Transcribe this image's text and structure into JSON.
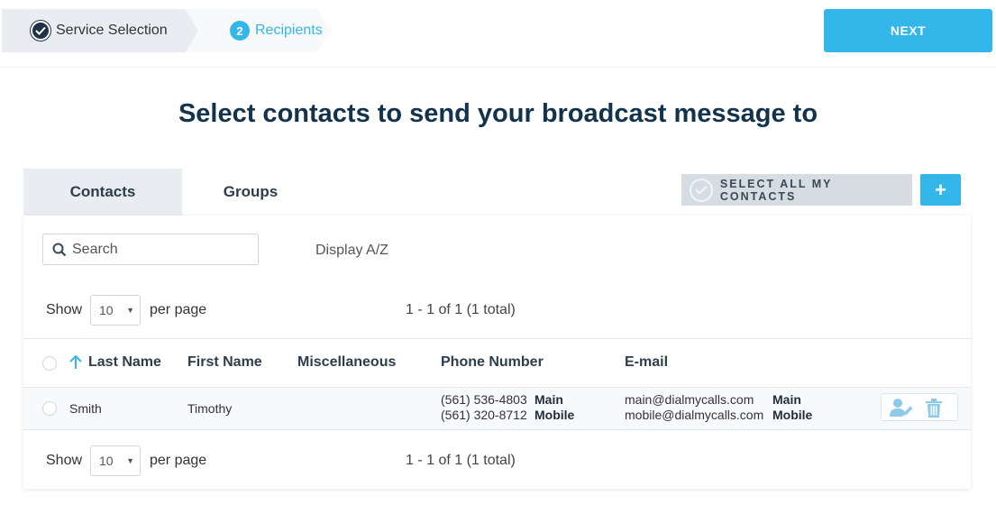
{
  "stepper": {
    "step1": {
      "label": "Service Selection"
    },
    "step2": {
      "number": "2",
      "label": "Recipients"
    }
  },
  "next_label": "NEXT",
  "title": "Select contacts to send your broadcast message to",
  "tabs": {
    "contacts": "Contacts",
    "groups": "Groups"
  },
  "select_all_label": "SELECT ALL MY CONTACTS",
  "add_label": "+",
  "search": {
    "placeholder": "Search"
  },
  "display_az": "Display A/Z",
  "pager": {
    "show": "Show",
    "per_value": "10",
    "per_page": "per page",
    "range": "1 - 1 of 1 (1 total)"
  },
  "table": {
    "headers": {
      "last_name": "Last Name",
      "first_name": "First Name",
      "misc": "Miscellaneous",
      "phone": "Phone Number",
      "email": "E-mail"
    },
    "rows": [
      {
        "last_name": "Smith",
        "first_name": "Timothy",
        "phones": [
          {
            "number": "(561) 536-4803",
            "type": "Main"
          },
          {
            "number": "(561) 320-8712",
            "type": "Mobile"
          }
        ],
        "emails": [
          {
            "address": "main@dialmycalls.com",
            "type": "Main"
          },
          {
            "address": "mobile@dialmycalls.com",
            "type": "Mobile"
          }
        ]
      }
    ]
  },
  "colors": {
    "accent": "#33b7ea",
    "navy": "#13324b",
    "tab_bg": "#e9edf1",
    "select_all_bg": "#d5dde3",
    "row_icon": "#8ecbe9"
  }
}
